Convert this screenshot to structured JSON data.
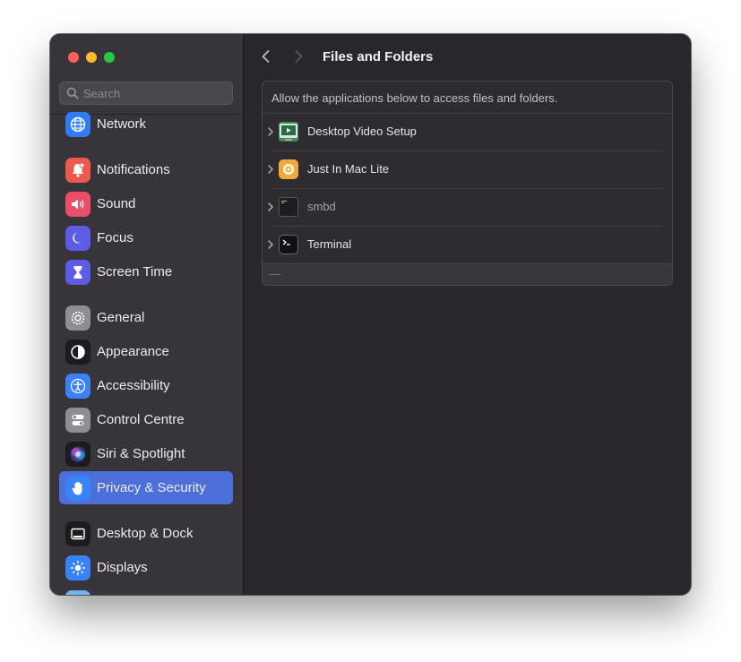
{
  "window": {
    "traffic_lights": [
      "close",
      "minimize",
      "zoom"
    ]
  },
  "sidebar": {
    "search_placeholder": "Search",
    "items": [
      {
        "label": "Network",
        "icon": "globe-icon",
        "color": "#2f7cf6"
      },
      {
        "label": "Notifications",
        "icon": "bell-icon",
        "color": "#ec5a4f"
      },
      {
        "label": "Sound",
        "icon": "speaker-icon",
        "color": "#ea4f69"
      },
      {
        "label": "Focus",
        "icon": "moon-icon",
        "color": "#5d5ce6"
      },
      {
        "label": "Screen Time",
        "icon": "hourglass-icon",
        "color": "#5d5ce6"
      },
      {
        "label": "General",
        "icon": "gear-icon",
        "color": "#8e8e93"
      },
      {
        "label": "Appearance",
        "icon": "appearance-icon",
        "color": "#1c1c1e"
      },
      {
        "label": "Accessibility",
        "icon": "accessibility-icon",
        "color": "#3a82f7"
      },
      {
        "label": "Control Centre",
        "icon": "toggles-icon",
        "color": "#8e8e93"
      },
      {
        "label": "Siri & Spotlight",
        "icon": "siri-icon",
        "color": "#1c1c1e"
      },
      {
        "label": "Privacy & Security",
        "icon": "hand-icon",
        "color": "#3a82f7",
        "selected": true
      },
      {
        "label": "Desktop & Dock",
        "icon": "dock-icon",
        "color": "#1c1c1e"
      },
      {
        "label": "Displays",
        "icon": "sun-icon",
        "color": "#3a82f7"
      }
    ]
  },
  "content": {
    "title": "Files and Folders",
    "description": "Allow the applications below to access files and folders.",
    "apps": [
      {
        "label": "Desktop Video Setup",
        "icon": "video-setup-icon"
      },
      {
        "label": "Just In Mac Lite",
        "icon": "just-in-mac-icon"
      },
      {
        "label": "smbd",
        "icon": "smbd-icon",
        "dimmed": true
      },
      {
        "label": "Terminal",
        "icon": "terminal-icon"
      }
    ],
    "remove_label": "—"
  },
  "colors": {
    "accent": "#4d6fd8",
    "window_bg": "#2a272c",
    "sidebar_bg": "#38353a"
  }
}
